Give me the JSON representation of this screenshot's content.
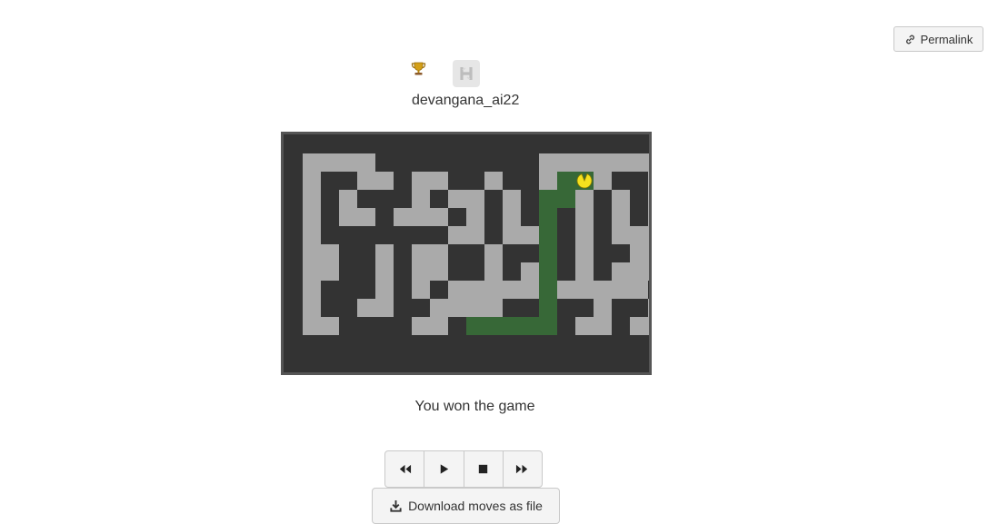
{
  "header": {
    "permalink_label": "Permalink",
    "player_name": "devangana_ai22",
    "trophy_icon": "trophy-icon",
    "logo_icon": "h-logo-icon"
  },
  "game": {
    "result_text": "You won the game",
    "wall_color": "#333333",
    "floor_color": "#aaaaaa",
    "path_color": "#376837",
    "player_color": "#f5e11e",
    "maze_rows": [
      "....XXXXXXXXX.......",
      ".XX..X..XX.XX.XX.XX.",
      ".X.XXX.X..X.X.X.X.X.",
      ".X..X...X.X.X.X.X.X.",
      ".XXXXXXX..X...X.X...",
      "..XX.X..XX.XXXX.XX..",
      "..XX.X..XX.X..X.X...",
      ".XXX.X.X...........X",
      ".XX..XX....XX.XX.XX.",
      "..XXXX..X...X.X..X.."
    ]
  },
  "controls": {
    "rewind_icon": "rewind-icon",
    "play_icon": "play-icon",
    "stop_icon": "stop-icon",
    "fast_forward_icon": "fast-forward-icon",
    "download_label": "Download moves as file",
    "download_icon": "download-icon"
  }
}
